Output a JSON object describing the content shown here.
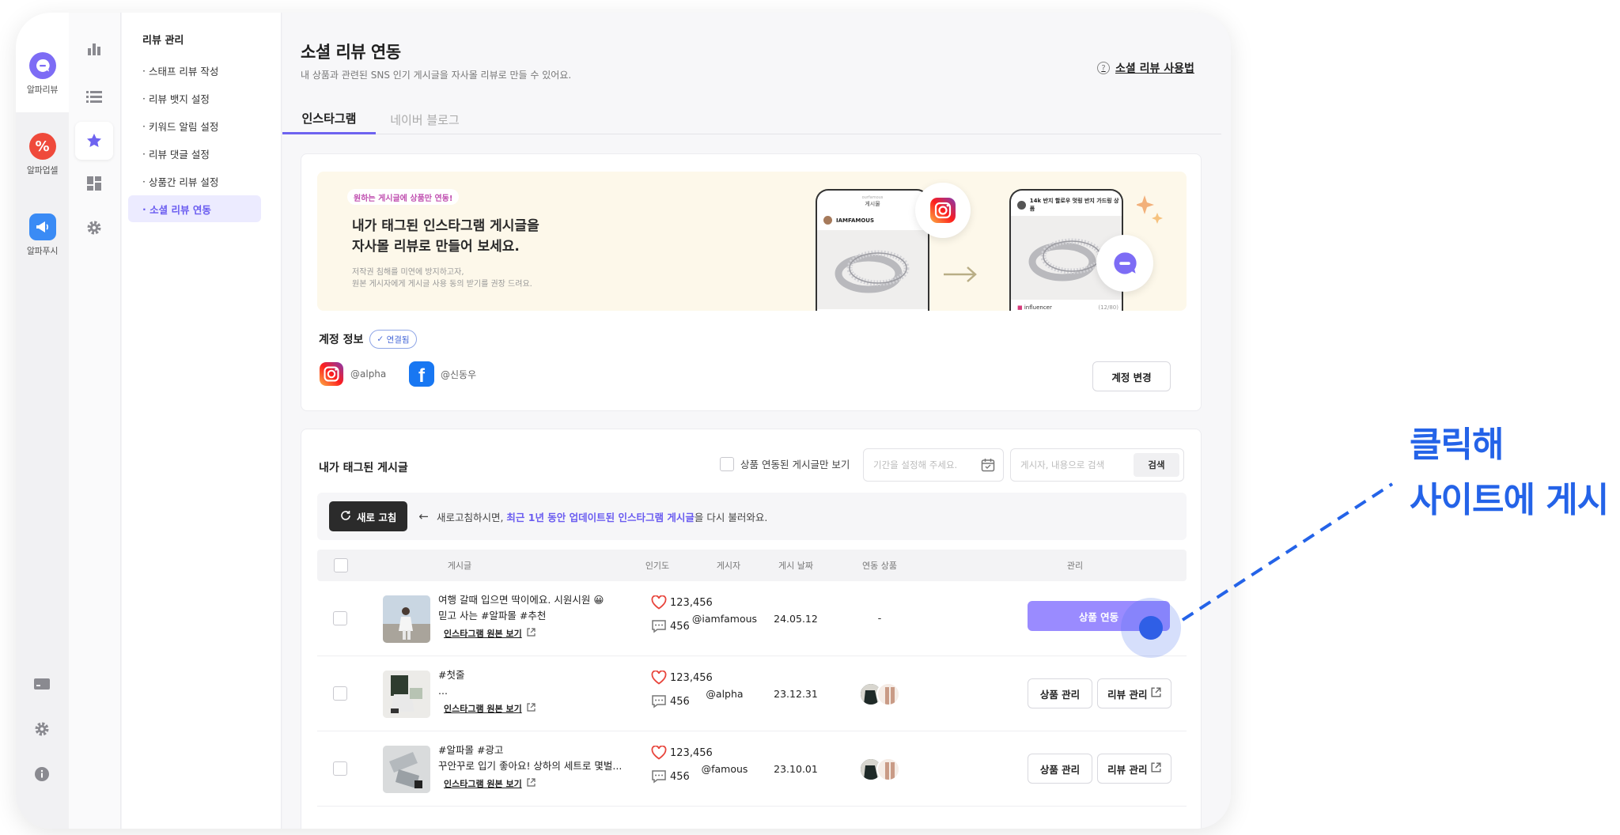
{
  "rail": {
    "items": [
      {
        "label": "알파리뷰",
        "icon": "alpha-review-icon"
      },
      {
        "label": "알파업셀",
        "icon": "alpha-upsell-icon"
      },
      {
        "label": "알파푸시",
        "icon": "alpha-push-icon"
      }
    ],
    "bottom_icons": [
      "card-icon",
      "gear-icon",
      "info-icon"
    ]
  },
  "col2": {
    "icons": [
      "bar-chart-icon",
      "list-icon",
      "star-icon",
      "dashboard-icon",
      "gear-icon"
    ]
  },
  "submenu": {
    "title": "리뷰 관리",
    "items": [
      {
        "label": "스태프 리뷰 작성"
      },
      {
        "label": "리뷰 뱃지 설정"
      },
      {
        "label": "키워드 알림 설정"
      },
      {
        "label": "리뷰 댓글 설정"
      },
      {
        "label": "상품간 리뷰 설정"
      },
      {
        "label": "소셜 리뷰 연동"
      }
    ]
  },
  "header": {
    "title": "소셜 리뷰 연동",
    "subtitle": "내 상품과 관련된 SNS 인기 게시글을 자사몰 리뷰로 만들 수 있어요.",
    "help_link": "소셜 리뷰 사용법",
    "help_icon": "?"
  },
  "tabs": [
    {
      "label": "인스타그램",
      "active": true
    },
    {
      "label": "네이버 블로그",
      "active": false
    }
  ],
  "banner": {
    "tag": "원하는 게시글에 상품만 연동!",
    "title_line1": "내가 태그된 인스타그램 게시글을",
    "title_line2": "자사몰 리뷰로 만들어 보세요.",
    "note_line1": "저작권 침해를 미연에 방지하고자,",
    "note_line2": "원본 게시자에게 게시글 사용 동의 받기를 권장 드려요.",
    "phone1": {
      "top": "게시물",
      "top_small": "ourfamous",
      "user": "IAMFAMOUS"
    },
    "phone2": {
      "top": "14k 반지 할로우 멋링 반지 가드링 상품",
      "user": "influencer",
      "count": "(12/80)"
    }
  },
  "account": {
    "title": "계정 정보",
    "linked_badge": "연결됨",
    "instagram": "@alpha",
    "facebook": "@신동우",
    "change_button": "계정 변경"
  },
  "posts": {
    "title": "내가 태그된 게시글",
    "filter_label": "상품 연동된 게시글만 보기",
    "date_placeholder": "기간을 설정해 주세요.",
    "search_placeholder": "게시자, 내용으로 검색",
    "search_button": "검색",
    "refresh_button": "새로 고침",
    "refresh_msg_before": "새로고침하시면,",
    "refresh_msg_highlight": "최근 1년 동안 업데이트된 인스타그램 게시글",
    "refresh_msg_after": "을 다시 불러와요.",
    "columns": [
      "게시글",
      "인기도",
      "게시자",
      "게시 날짜",
      "연동 상품",
      "관리"
    ],
    "link_label": "인스타그램 원본 보기",
    "rows": [
      {
        "line1": "여행 갈때 입으면 딱이에요. 시원시원 😀",
        "line2": "믿고 사는 #알파몰 #추천",
        "likes": "123,456",
        "comments": "456",
        "poster": "@iamfamous",
        "date": "24.05.12",
        "linked": "-",
        "action": "상품 연동"
      },
      {
        "line1": "#첫줄",
        "line2": "...",
        "likes": "123,456",
        "comments": "456",
        "poster": "@alpha",
        "date": "23.12.31",
        "action1": "상품 관리",
        "action2": "리뷰 관리"
      },
      {
        "line1": "#알파몰 #광고",
        "line2": "꾸안꾸로 입기 좋아요! 상하의 세트로 몇벌...",
        "likes": "123,456",
        "comments": "456",
        "poster": "@famous",
        "date": "23.10.01",
        "action1": "상품 관리",
        "action2": "리뷰 관리"
      }
    ]
  },
  "annotation": {
    "line1": "클릭해",
    "line2": "사이트에 게시",
    "color": "#2463e8"
  },
  "colors": {
    "accent": "#6e63f0",
    "primary_button": "#9a8bff",
    "upsell_red": "#ef4a3b",
    "push_blue": "#3a8bf5"
  }
}
